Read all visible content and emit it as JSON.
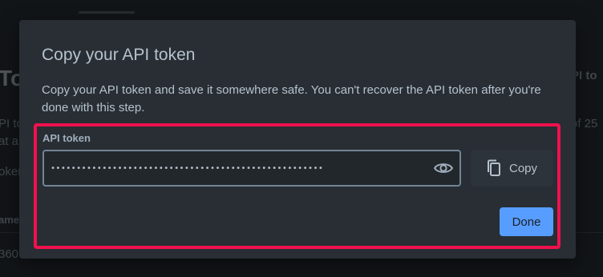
{
  "background": {
    "title_fragment": "To",
    "line_fragment_1": "PI to",
    "line_fragment_2": "at a",
    "line_fragment_3": "oken",
    "column_fragment": "ame",
    "row_fragment": "360",
    "right_title_fragment": "PI to",
    "right_count_fragment": "of 25"
  },
  "modal": {
    "title": "Copy your API token",
    "description": "Copy your API token and save it somewhere safe. You can't recover the API token after you're done with this step.",
    "field_label": "API token",
    "token_masked": "•••••••••••••••••••••••••••••••••••••••••••••••••••••",
    "copy_label": "Copy",
    "done_label": "Done"
  },
  "colors": {
    "modal_bg": "#282e33",
    "primary": "#579dff",
    "highlight": "#f0114e"
  },
  "icons": {
    "reveal": "eye-icon",
    "copy": "copy-icon"
  }
}
